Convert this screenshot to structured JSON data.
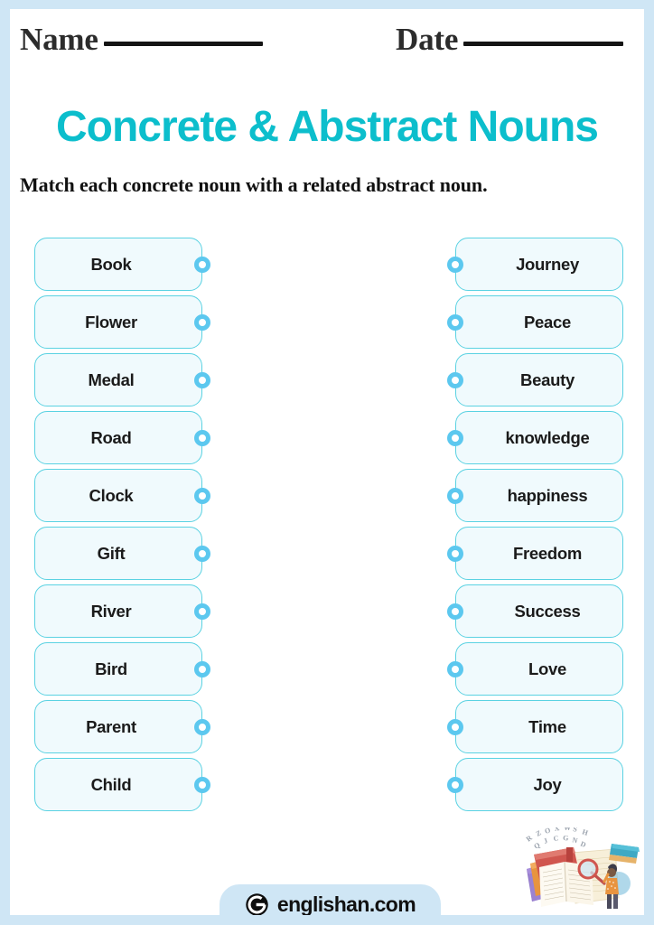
{
  "header": {
    "name_label": "Name",
    "date_label": "Date"
  },
  "title": "Concrete & Abstract Nouns",
  "subtitle": "Match each concrete noun with a related abstract noun.",
  "match": {
    "left_column": [
      {
        "label": "Book"
      },
      {
        "label": "Flower"
      },
      {
        "label": "Medal"
      },
      {
        "label": "Road"
      },
      {
        "label": "Clock"
      },
      {
        "label": "Gift"
      },
      {
        "label": "River"
      },
      {
        "label": "Bird"
      },
      {
        "label": "Parent"
      },
      {
        "label": "Child"
      }
    ],
    "right_column": [
      {
        "label": "Journey"
      },
      {
        "label": "Peace"
      },
      {
        "label": "Beauty"
      },
      {
        "label": "knowledge"
      },
      {
        "label": "happiness"
      },
      {
        "label": "Freedom"
      },
      {
        "label": "Success"
      },
      {
        "label": "Love"
      },
      {
        "label": "Time"
      },
      {
        "label": "Joy"
      }
    ]
  },
  "footer": {
    "brand_name": "englishan.com",
    "brand_icon": "englishan-e-logo-icon"
  },
  "illustration": {
    "name": "books-and-magnifying-glass-illustration"
  },
  "colors": {
    "frame": "#cfe6f5",
    "page": "#ffffff",
    "title": "#0cbecc",
    "pill_fill": "#f0fafd",
    "pill_border": "#5ad2e2",
    "connector": "#5cc8ef",
    "rule": "#141414"
  }
}
